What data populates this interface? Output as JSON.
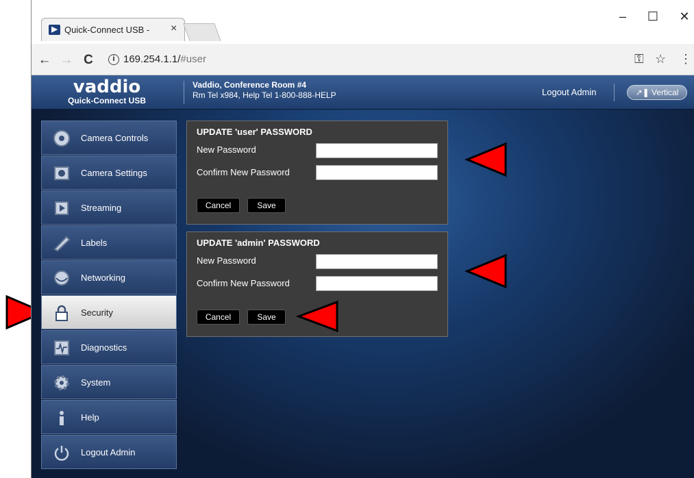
{
  "browser": {
    "tab_title": "Quick-Connect USB - ",
    "tab_close": "×",
    "minimize": "–",
    "maximize": "☐",
    "close": "✕",
    "back": "←",
    "forward": "→",
    "reload": "C",
    "url_host": "169.254.1.1/",
    "url_path": "#user",
    "info_glyph": "i",
    "key_glyph": "⚿",
    "star_glyph": "☆",
    "menu_glyph": "⋮"
  },
  "header": {
    "logo_brand": "vaddio",
    "logo_product": "Quick-Connect USB",
    "device_line1": "Vaddio, Conference Room #4",
    "device_line2": "Rm Tel x984, Help Tel 1-800-888-HELP",
    "logout_label": "Logout Admin",
    "vertical_label": "Vertical"
  },
  "sidebar": {
    "items": [
      {
        "label": "Camera Controls",
        "icon": "camera-controls-icon"
      },
      {
        "label": "Camera Settings",
        "icon": "camera-settings-icon"
      },
      {
        "label": "Streaming",
        "icon": "streaming-icon"
      },
      {
        "label": "Labels",
        "icon": "labels-icon"
      },
      {
        "label": "Networking",
        "icon": "networking-icon"
      },
      {
        "label": "Security",
        "icon": "lock-icon",
        "active": true
      },
      {
        "label": "Diagnostics",
        "icon": "diagnostics-icon"
      },
      {
        "label": "System",
        "icon": "gear-icon"
      },
      {
        "label": "Help",
        "icon": "help-icon"
      },
      {
        "label": "Logout Admin",
        "icon": "power-icon"
      }
    ]
  },
  "user_panel": {
    "title": "UPDATE 'user' PASSWORD",
    "new_password_label": "New Password",
    "confirm_password_label": "Confirm New Password",
    "new_password_value": "",
    "confirm_password_value": "",
    "cancel_label": "Cancel",
    "save_label": "Save"
  },
  "admin_panel": {
    "title": "UPDATE 'admin' PASSWORD",
    "new_password_label": "New Password",
    "confirm_password_label": "Confirm New Password",
    "new_password_value": "",
    "confirm_password_value": "",
    "cancel_label": "Cancel",
    "save_label": "Save"
  },
  "annotation_color": "#ff0000"
}
